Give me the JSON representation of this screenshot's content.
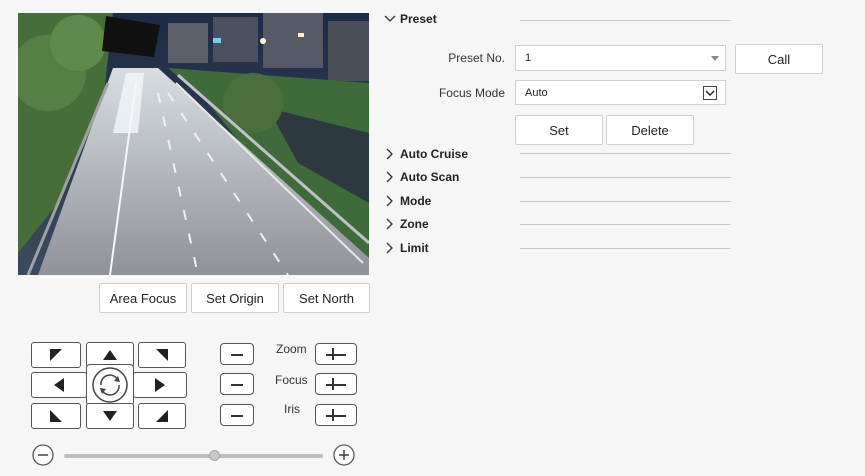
{
  "video_actions": {
    "area_focus": "Area Focus",
    "set_origin": "Set Origin",
    "set_north": "Set North"
  },
  "ptz": {
    "zoom_label": "Zoom",
    "focus_label": "Focus",
    "iris_label": "Iris",
    "speed_level": 0.58,
    "icons": [
      "arrow-up-left-icon",
      "arrow-up-icon",
      "arrow-up-right-icon",
      "arrow-left-icon",
      "auto-rotate-icon",
      "arrow-right-icon",
      "arrow-down-left-icon",
      "arrow-down-icon",
      "arrow-down-right-icon",
      "minus-icon",
      "plus-icon"
    ]
  },
  "preset": {
    "title": "Preset",
    "preset_no_label": "Preset No.",
    "preset_no_value": "1",
    "call_label": "Call",
    "focus_mode_label": "Focus Mode",
    "focus_mode_value": "Auto",
    "set_label": "Set",
    "delete_label": "Delete"
  },
  "sections": [
    {
      "title": "Auto Cruise"
    },
    {
      "title": "Auto Scan"
    },
    {
      "title": "Mode"
    },
    {
      "title": "Zone"
    },
    {
      "title": "Limit"
    }
  ],
  "colors": {
    "background": "#f6f6f6",
    "button": "#ffffff",
    "border": "#cfcfcf",
    "divider": "#c9c9c9"
  }
}
